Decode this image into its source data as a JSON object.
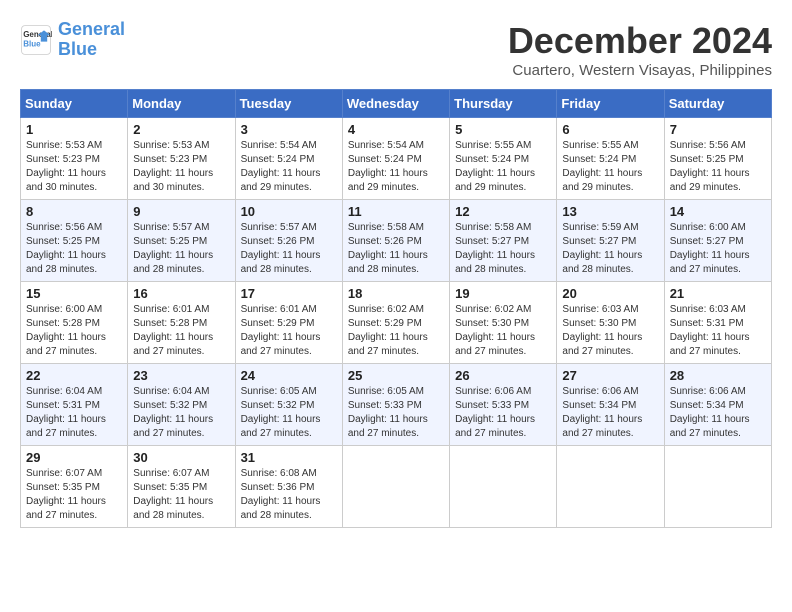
{
  "logo": {
    "text_general": "General",
    "text_blue": "Blue"
  },
  "title": "December 2024",
  "subtitle": "Cuartero, Western Visayas, Philippines",
  "days_of_week": [
    "Sunday",
    "Monday",
    "Tuesday",
    "Wednesday",
    "Thursday",
    "Friday",
    "Saturday"
  ],
  "weeks": [
    [
      {
        "day": "1",
        "info": "Sunrise: 5:53 AM\nSunset: 5:23 PM\nDaylight: 11 hours\nand 30 minutes."
      },
      {
        "day": "2",
        "info": "Sunrise: 5:53 AM\nSunset: 5:23 PM\nDaylight: 11 hours\nand 30 minutes."
      },
      {
        "day": "3",
        "info": "Sunrise: 5:54 AM\nSunset: 5:24 PM\nDaylight: 11 hours\nand 29 minutes."
      },
      {
        "day": "4",
        "info": "Sunrise: 5:54 AM\nSunset: 5:24 PM\nDaylight: 11 hours\nand 29 minutes."
      },
      {
        "day": "5",
        "info": "Sunrise: 5:55 AM\nSunset: 5:24 PM\nDaylight: 11 hours\nand 29 minutes."
      },
      {
        "day": "6",
        "info": "Sunrise: 5:55 AM\nSunset: 5:24 PM\nDaylight: 11 hours\nand 29 minutes."
      },
      {
        "day": "7",
        "info": "Sunrise: 5:56 AM\nSunset: 5:25 PM\nDaylight: 11 hours\nand 29 minutes."
      }
    ],
    [
      {
        "day": "8",
        "info": "Sunrise: 5:56 AM\nSunset: 5:25 PM\nDaylight: 11 hours\nand 28 minutes."
      },
      {
        "day": "9",
        "info": "Sunrise: 5:57 AM\nSunset: 5:25 PM\nDaylight: 11 hours\nand 28 minutes."
      },
      {
        "day": "10",
        "info": "Sunrise: 5:57 AM\nSunset: 5:26 PM\nDaylight: 11 hours\nand 28 minutes."
      },
      {
        "day": "11",
        "info": "Sunrise: 5:58 AM\nSunset: 5:26 PM\nDaylight: 11 hours\nand 28 minutes."
      },
      {
        "day": "12",
        "info": "Sunrise: 5:58 AM\nSunset: 5:27 PM\nDaylight: 11 hours\nand 28 minutes."
      },
      {
        "day": "13",
        "info": "Sunrise: 5:59 AM\nSunset: 5:27 PM\nDaylight: 11 hours\nand 28 minutes."
      },
      {
        "day": "14",
        "info": "Sunrise: 6:00 AM\nSunset: 5:27 PM\nDaylight: 11 hours\nand 27 minutes."
      }
    ],
    [
      {
        "day": "15",
        "info": "Sunrise: 6:00 AM\nSunset: 5:28 PM\nDaylight: 11 hours\nand 27 minutes."
      },
      {
        "day": "16",
        "info": "Sunrise: 6:01 AM\nSunset: 5:28 PM\nDaylight: 11 hours\nand 27 minutes."
      },
      {
        "day": "17",
        "info": "Sunrise: 6:01 AM\nSunset: 5:29 PM\nDaylight: 11 hours\nand 27 minutes."
      },
      {
        "day": "18",
        "info": "Sunrise: 6:02 AM\nSunset: 5:29 PM\nDaylight: 11 hours\nand 27 minutes."
      },
      {
        "day": "19",
        "info": "Sunrise: 6:02 AM\nSunset: 5:30 PM\nDaylight: 11 hours\nand 27 minutes."
      },
      {
        "day": "20",
        "info": "Sunrise: 6:03 AM\nSunset: 5:30 PM\nDaylight: 11 hours\nand 27 minutes."
      },
      {
        "day": "21",
        "info": "Sunrise: 6:03 AM\nSunset: 5:31 PM\nDaylight: 11 hours\nand 27 minutes."
      }
    ],
    [
      {
        "day": "22",
        "info": "Sunrise: 6:04 AM\nSunset: 5:31 PM\nDaylight: 11 hours\nand 27 minutes."
      },
      {
        "day": "23",
        "info": "Sunrise: 6:04 AM\nSunset: 5:32 PM\nDaylight: 11 hours\nand 27 minutes."
      },
      {
        "day": "24",
        "info": "Sunrise: 6:05 AM\nSunset: 5:32 PM\nDaylight: 11 hours\nand 27 minutes."
      },
      {
        "day": "25",
        "info": "Sunrise: 6:05 AM\nSunset: 5:33 PM\nDaylight: 11 hours\nand 27 minutes."
      },
      {
        "day": "26",
        "info": "Sunrise: 6:06 AM\nSunset: 5:33 PM\nDaylight: 11 hours\nand 27 minutes."
      },
      {
        "day": "27",
        "info": "Sunrise: 6:06 AM\nSunset: 5:34 PM\nDaylight: 11 hours\nand 27 minutes."
      },
      {
        "day": "28",
        "info": "Sunrise: 6:06 AM\nSunset: 5:34 PM\nDaylight: 11 hours\nand 27 minutes."
      }
    ],
    [
      {
        "day": "29",
        "info": "Sunrise: 6:07 AM\nSunset: 5:35 PM\nDaylight: 11 hours\nand 27 minutes."
      },
      {
        "day": "30",
        "info": "Sunrise: 6:07 AM\nSunset: 5:35 PM\nDaylight: 11 hours\nand 28 minutes."
      },
      {
        "day": "31",
        "info": "Sunrise: 6:08 AM\nSunset: 5:36 PM\nDaylight: 11 hours\nand 28 minutes."
      },
      {
        "day": "",
        "info": ""
      },
      {
        "day": "",
        "info": ""
      },
      {
        "day": "",
        "info": ""
      },
      {
        "day": "",
        "info": ""
      }
    ]
  ]
}
